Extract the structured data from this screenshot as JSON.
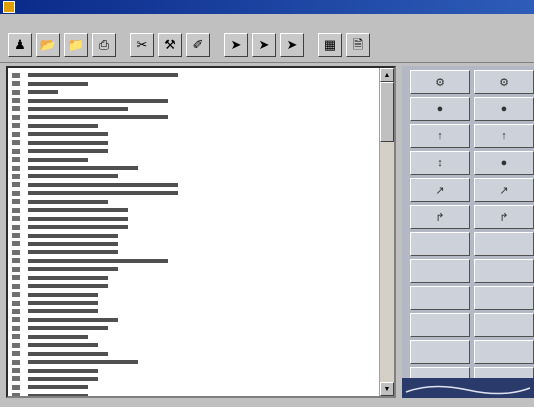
{
  "window": {
    "title": "",
    "title_right": ""
  },
  "menu": {
    "items": []
  },
  "toolbar": {
    "buttons": [
      {
        "icon": "green-figure-icon"
      },
      {
        "icon": "open-folder-icon"
      },
      {
        "icon": "folder-icon"
      },
      {
        "icon": "printer-icon"
      },
      {
        "icon": "scissors-icon"
      },
      {
        "icon": "hammer-icon"
      },
      {
        "icon": "paint-icon"
      },
      {
        "icon": "cursor-a-icon"
      },
      {
        "icon": "cursor-b-icon"
      },
      {
        "icon": "cursor-c-icon"
      },
      {
        "icon": "view-icon"
      },
      {
        "icon": "document-icon"
      }
    ]
  },
  "editor": {
    "lines": []
  },
  "panel": {
    "buttons": []
  },
  "colors": {
    "titlebar": "#0a2a8a",
    "editor_bg": "#ffffff",
    "panel_bg": "#b4b8c4"
  }
}
